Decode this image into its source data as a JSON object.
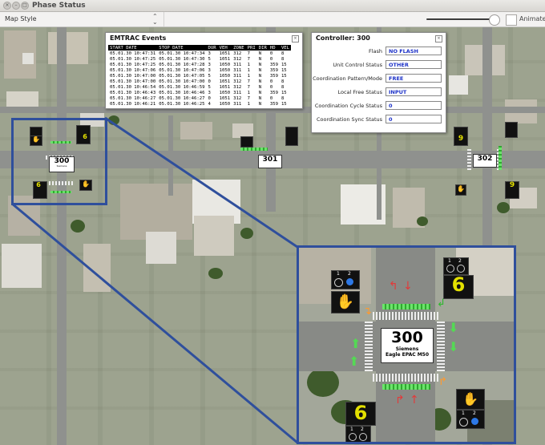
{
  "window": {
    "title": "Phase Status"
  },
  "toolbar": {
    "map_style_label": "Map Style",
    "animate_label": "Animate"
  },
  "events_panel": {
    "title": "EMTRAC Events",
    "columns": [
      "START DATE",
      "STOP DATE",
      "DUR",
      "VEH",
      "ZONE",
      "PRI",
      "DIR",
      "HD",
      "VEL"
    ],
    "rows": [
      [
        "05.01.30 10:47:31",
        "05.01.30 10:47:34",
        "3",
        "1051",
        "312",
        "7",
        "N",
        "0",
        "8"
      ],
      [
        "05.01.30 10:47:25",
        "05.01.30 10:47:30",
        "5",
        "1051",
        "312",
        "7",
        "N",
        "0",
        "8"
      ],
      [
        "05.01.30 10:47:25",
        "05.01.30 10:47:28",
        "3",
        "1050",
        "311",
        "1",
        "N",
        "359",
        "15"
      ],
      [
        "05.01.30 10:47:06",
        "05.01.30 10:47:06",
        "3",
        "1050",
        "311",
        "1",
        "N",
        "359",
        "15"
      ],
      [
        "05.01.30 10:47:00",
        "05.01.30 10:47:05",
        "5",
        "1050",
        "311",
        "1",
        "N",
        "359",
        "15"
      ],
      [
        "05.01.30 10:47:00",
        "05.01.30 10:47:00",
        "0",
        "1051",
        "312",
        "7",
        "N",
        "0",
        "8"
      ],
      [
        "05.01.30 10:46:54",
        "05.01.30 10:46:59",
        "5",
        "1051",
        "312",
        "7",
        "N",
        "0",
        "8"
      ],
      [
        "05.01.30 10:46:43",
        "05.01.30 10:46:46",
        "3",
        "1050",
        "311",
        "1",
        "N",
        "359",
        "15"
      ],
      [
        "05.01.30 10:46:27",
        "05.01.30 10:46:27",
        "0",
        "1051",
        "312",
        "7",
        "N",
        "0",
        "8"
      ],
      [
        "05.01.30 10:46:21",
        "05.01.30 10:46:25",
        "4",
        "1050",
        "311",
        "1",
        "N",
        "359",
        "15"
      ]
    ]
  },
  "controller_panel": {
    "title": "Controller: 300",
    "fields": [
      {
        "label": "Flash",
        "value": "NO FLASH"
      },
      {
        "label": "Unit Control Status",
        "value": "OTHER"
      },
      {
        "label": "Coordination Pattern/Mode",
        "value": "FREE"
      },
      {
        "label": "Local Free Status",
        "value": "INPUT"
      },
      {
        "label": "Coordination Cycle Status",
        "value": "0"
      },
      {
        "label": "Coordination Sync Status",
        "value": "0"
      }
    ]
  },
  "map": {
    "intersections": [
      {
        "id": "300",
        "vendor": "Siemens",
        "model": "Eagle EPAC M50"
      },
      {
        "id": "301"
      },
      {
        "id": "302"
      }
    ],
    "signal_numbers": [
      "6",
      "6",
      "9",
      "9",
      "6",
      "6"
    ],
    "ring_labels": [
      "1",
      "2"
    ]
  },
  "colors": {
    "highlight_frame": "#2f4f9c",
    "signal_number": "#e3e000",
    "field_value": "#1d32c8",
    "walk_bar": "#3fbf3f"
  }
}
